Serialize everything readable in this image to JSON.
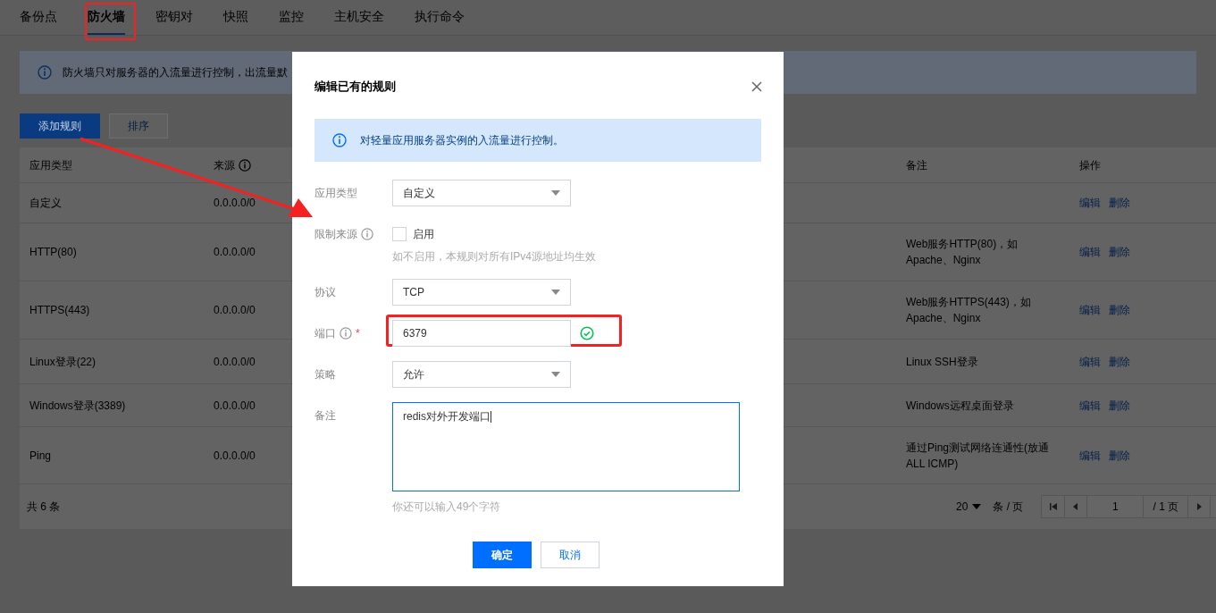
{
  "tabs": [
    {
      "label": "备份点",
      "selected": false
    },
    {
      "label": "防火墙",
      "selected": true
    },
    {
      "label": "密钥对",
      "selected": false
    },
    {
      "label": "快照",
      "selected": false
    },
    {
      "label": "监控",
      "selected": false
    },
    {
      "label": "主机安全",
      "selected": false
    },
    {
      "label": "执行命令",
      "selected": false
    }
  ],
  "notice": "防火墙只对服务器的入流量进行控制，出流量默",
  "toolbar": {
    "add_button": "添加规则",
    "sort_button": "排序"
  },
  "table": {
    "columns": [
      {
        "label": "应用类型",
        "info": false
      },
      {
        "label": "来源",
        "info": true
      },
      {
        "label": "备注",
        "info": false
      },
      {
        "label": "操作",
        "info": false
      }
    ],
    "rows": [
      {
        "type": "自定义",
        "source": "0.0.0.0/0",
        "note": "",
        "actions": [
          "编辑",
          "删除"
        ]
      },
      {
        "type": "HTTP(80)",
        "source": "0.0.0.0/0",
        "note": "Web服务HTTP(80)，如\nApache、Nginx",
        "actions": [
          "编辑",
          "删除"
        ]
      },
      {
        "type": "HTTPS(443)",
        "source": "0.0.0.0/0",
        "note": "Web服务HTTPS(443)，如\nApache、Nginx",
        "actions": [
          "编辑",
          "删除"
        ]
      },
      {
        "type": "Linux登录(22)",
        "source": "0.0.0.0/0",
        "note": "Linux SSH登录",
        "actions": [
          "编辑",
          "删除"
        ]
      },
      {
        "type": "Windows登录(3389)",
        "source": "0.0.0.0/0",
        "note": "Windows远程桌面登录",
        "actions": [
          "编辑",
          "删除"
        ]
      },
      {
        "type": "Ping",
        "source": "0.0.0.0/0",
        "note": "通过Ping测试网络连通性(放通\nALL ICMP)",
        "actions": [
          "编辑",
          "删除"
        ]
      }
    ]
  },
  "footer": {
    "total": "共 6 条",
    "page_size": "20",
    "page_size_unit": "条 / 页",
    "page": "1",
    "page_total": "/ 1 页"
  },
  "dialog": {
    "title": "编辑已有的规则",
    "notice": "对轻量应用服务器实例的入流量进行控制。",
    "fields": [
      {
        "kind": "select",
        "label": "应用类型",
        "value": "自定义"
      },
      {
        "kind": "checkbox",
        "label": "限制来源",
        "info": true,
        "option": "启用",
        "checked": false,
        "hint": "如不启用，本规则对所有IPv4源地址均生效"
      },
      {
        "kind": "select",
        "label": "协议",
        "value": "TCP"
      },
      {
        "kind": "input",
        "label": "端口",
        "info": true,
        "required_mark": "*",
        "value": "6379",
        "valid": true
      },
      {
        "kind": "select",
        "label": "策略",
        "value": "允许"
      },
      {
        "kind": "textarea",
        "label": "备注",
        "value": "redis对外开发端口",
        "hint": "你还可以输入49个字符"
      }
    ],
    "buttons": {
      "ok": "确定",
      "cancel": "取消"
    }
  }
}
